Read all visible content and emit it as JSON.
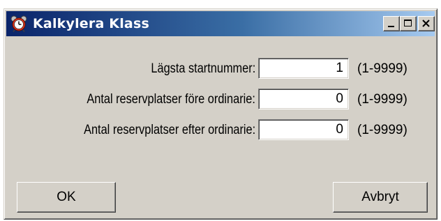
{
  "window": {
    "title": "Kalkylera Klass",
    "icon": "alarm-clock-icon",
    "controls": {
      "minimize": "minimize-icon",
      "maximize": "maximize-icon",
      "close": "close-icon"
    }
  },
  "form": {
    "rows": [
      {
        "label": "Lägsta startnummer:",
        "value": "1",
        "range": "(1-9999)"
      },
      {
        "label": "Antal reservplatser före ordinarie:",
        "value": "0",
        "range": "(1-9999)"
      },
      {
        "label": "Antal reservplatser efter ordinarie:",
        "value": "0",
        "range": "(1-9999)"
      }
    ]
  },
  "buttons": {
    "ok": "OK",
    "cancel": "Avbryt"
  },
  "colors": {
    "titlebar_start": "#0a246a",
    "titlebar_end": "#a6caf0",
    "face": "#d4d0c8"
  }
}
